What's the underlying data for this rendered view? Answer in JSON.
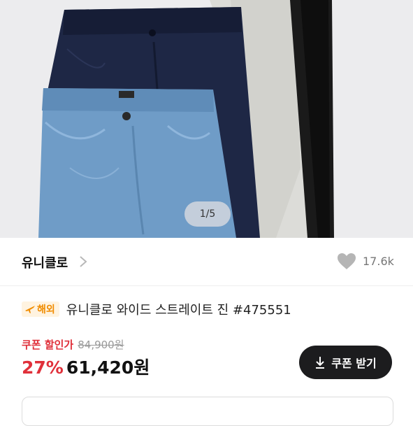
{
  "gallery": {
    "pager": "1/5",
    "image_alt": "denim-jeans-photo"
  },
  "product": {
    "brand": "유니클로",
    "like_count": "17.6k",
    "badge": "해외",
    "title": "유니클로 와이드 스트레이트 진 #475551",
    "coupon_label": "쿠폰 할인가",
    "original_price": "84,900원",
    "discount": "27%",
    "final_price": "61,420원",
    "coupon_button": "쿠폰 받기"
  },
  "colors": {
    "accent_red": "#e0303a",
    "badge_orange": "#f08c00",
    "button_dark": "#1c1c1e"
  },
  "icons": [
    "chevron-right-icon",
    "heart-icon",
    "airplane-icon",
    "download-icon"
  ]
}
